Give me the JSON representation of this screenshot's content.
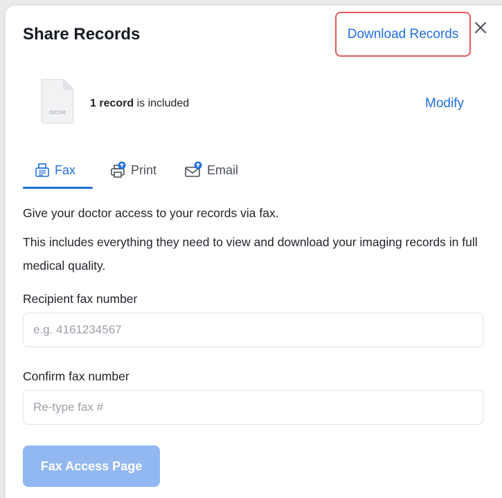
{
  "header": {
    "title": "Share Records",
    "download_label": "Download Records",
    "close_label": "×"
  },
  "records": {
    "count_text": "1 record",
    "suffix_text": " is included",
    "thumb_label": "DICOM",
    "modify_label": "Modify"
  },
  "tabs": [
    {
      "label": "Fax",
      "icon": "fax-icon",
      "active": true
    },
    {
      "label": "Print",
      "icon": "printer-icon",
      "active": false
    },
    {
      "label": "Email",
      "icon": "email-icon",
      "active": false
    }
  ],
  "body": {
    "line1": "Give your doctor access to your records via fax.",
    "line2": "This includes everything they need to view and download your imaging records in full medical quality."
  },
  "form": {
    "recipient_label": "Recipient fax number",
    "recipient_placeholder": "e.g. 4161234567",
    "confirm_label": "Confirm fax number",
    "confirm_placeholder": "Re-type fax #",
    "submit_label": "Fax Access Page"
  },
  "colors": {
    "accent": "#1f6fe0",
    "highlight_border": "#e65a5a",
    "disabled_button": "#92b8f2"
  }
}
